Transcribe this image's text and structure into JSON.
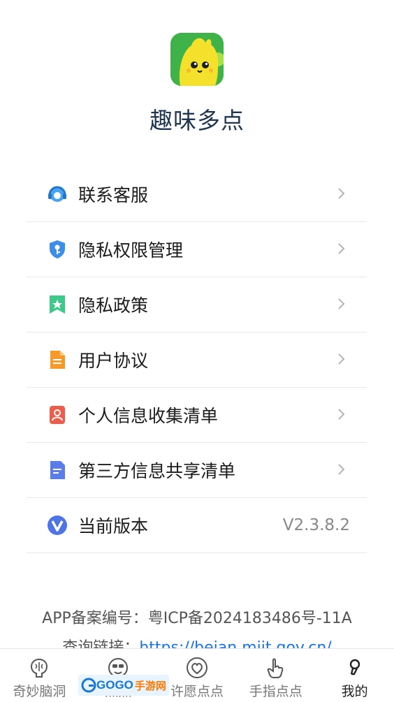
{
  "app": {
    "name": "趣味多点"
  },
  "menu": [
    {
      "icon": "headset-icon",
      "label": "联系客服"
    },
    {
      "icon": "shield-key-icon",
      "label": "隐私权限管理"
    },
    {
      "icon": "bookmark-star-icon",
      "label": "隐私政策"
    },
    {
      "icon": "document-icon",
      "label": "用户协议"
    },
    {
      "icon": "person-card-icon",
      "label": "个人信息收集清单"
    },
    {
      "icon": "file-lines-icon",
      "label": "第三方信息共享清单"
    },
    {
      "icon": "v-badge-icon",
      "label": "当前版本",
      "value": "V2.3.8.2"
    }
  ],
  "footer": {
    "filing": "APP备案编号：粤ICP备2024183486号-11A",
    "query_label": "查询链接：",
    "query_link": "https://beian.miit.gov.cn/"
  },
  "tabs": [
    {
      "icon": "brain-icon",
      "label": "奇妙脑洞"
    },
    {
      "icon": "face-icon",
      "label": "点点"
    },
    {
      "icon": "heart-icon",
      "label": "许愿点点"
    },
    {
      "icon": "hand-pointer-icon",
      "label": "手指点点"
    },
    {
      "icon": "profile-icon",
      "label": "我的"
    }
  ],
  "watermark": {
    "text": "GOGO",
    "text2": "手游网"
  },
  "colors": {
    "title": "#1f3550",
    "link": "#1a73e8",
    "logo_bg": "#3fb24a"
  }
}
